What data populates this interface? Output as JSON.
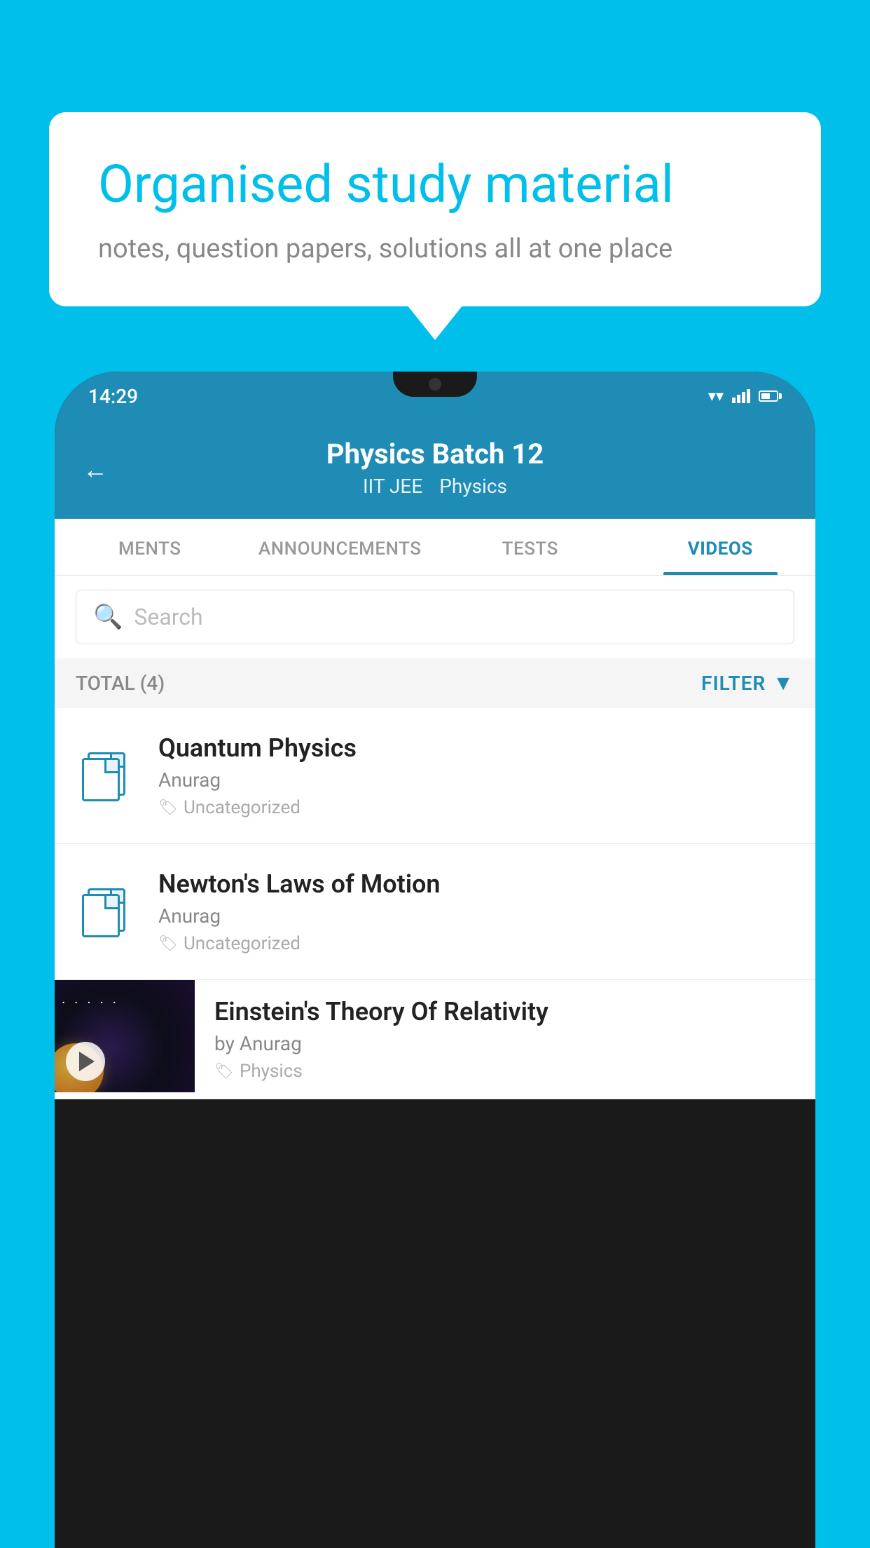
{
  "background_color": "#00BFEA",
  "speech_bubble": {
    "heading": "Organised study material",
    "subtext": "notes, question papers, solutions all at one place"
  },
  "status_bar": {
    "time": "14:29",
    "wifi": "▾",
    "signal": "signal",
    "battery": "battery"
  },
  "app_header": {
    "back_label": "←",
    "title": "Physics Batch 12",
    "subtitle_left": "IIT JEE",
    "subtitle_right": "Physics"
  },
  "tabs": [
    {
      "label": "MENTS",
      "active": false
    },
    {
      "label": "ANNOUNCEMENTS",
      "active": false
    },
    {
      "label": "TESTS",
      "active": false
    },
    {
      "label": "VIDEOS",
      "active": true
    }
  ],
  "search": {
    "placeholder": "Search"
  },
  "filter_bar": {
    "total_label": "TOTAL (4)",
    "filter_label": "FILTER"
  },
  "list_items": [
    {
      "title": "Quantum Physics",
      "author": "Anurag",
      "tag": "Uncategorized",
      "type": "file"
    },
    {
      "title": "Newton's Laws of Motion",
      "author": "Anurag",
      "tag": "Uncategorized",
      "type": "file"
    }
  ],
  "video_item": {
    "title": "Einstein's Theory Of Relativity",
    "author": "by Anurag",
    "tag": "Physics"
  }
}
